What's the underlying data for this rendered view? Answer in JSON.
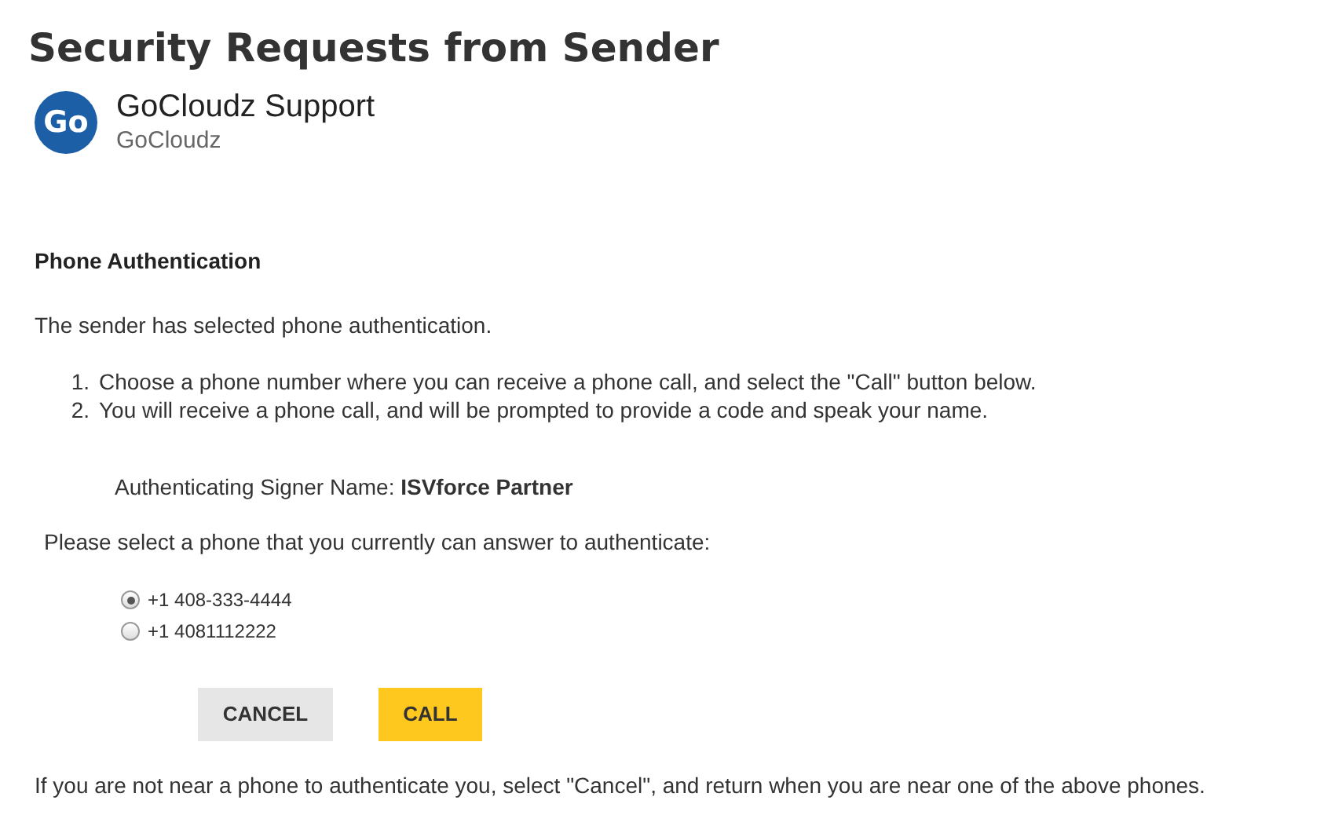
{
  "title": "Security Requests from Sender",
  "sender": {
    "logo_text": "Go",
    "name": "GoCloudz Support",
    "company": "GoCloudz"
  },
  "section_title": "Phone Authentication",
  "intro": "The sender has selected phone authentication.",
  "steps": [
    {
      "number": "1.",
      "text": "Choose a phone number where you can receive a phone call, and select the \"Call\" button below."
    },
    {
      "number": "2.",
      "text": "You will receive a phone call, and will be prompted to provide a code and speak your name."
    }
  ],
  "signer": "Authenticating Signer Name: **ISVforce Partner**",
  "prompt": "Please select a phone that you currently can answer to authenticate:",
  "phones": [
    {
      "label": "+1 408-333-4444",
      "selected": true
    },
    {
      "label": "+1 4081112222",
      "selected": false
    }
  ],
  "buttons": [
    {
      "label": "CANCEL",
      "kind": "secondary"
    },
    {
      "label": "CALL",
      "kind": "primary"
    }
  ],
  "footer": "If you are not near a phone to authenticate you, select \"Cancel\", and return when you are near one of the above phones."
}
